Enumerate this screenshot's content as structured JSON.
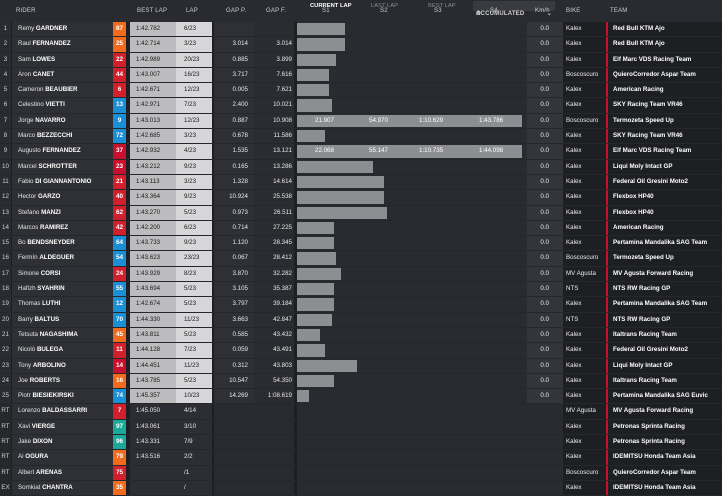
{
  "header": {
    "rider": "RIDER",
    "best_lap": "BEST LAP",
    "lap": "LAP",
    "gap_p": "GAP P.",
    "gap_f": "GAP F.",
    "bike": "BIKE",
    "team": "TEAM",
    "tabs": {
      "current": "CURRENT LAP",
      "last": "LAST LAP",
      "best": "BEST LAP",
      "accumulated": "ACCUMULATED"
    },
    "s1": "S1",
    "s2": "S2",
    "s3": "S3",
    "s4": "S4",
    "kmh": "Km/h"
  },
  "colors": {
    "team_accent": "#c8102e",
    "sector_bar": "#8d8e91"
  },
  "rows": [
    {
      "pos": "1",
      "first": "Remy",
      "last": "GARDNER",
      "num": "87",
      "num_color": "#f26a1b",
      "best": "1:42.782",
      "lap": "6/23",
      "gap_p": "",
      "gap_f": "",
      "bar": 0.21,
      "s1": "",
      "s2": "",
      "s3": "",
      "s4": "",
      "kmh": "0.0",
      "bike": "Kalex",
      "team": "Red Bull KTM Ajo"
    },
    {
      "pos": "2",
      "first": "Raul",
      "last": "FERNANDEZ",
      "num": "25",
      "num_color": "#f26a1b",
      "best": "1:42.714",
      "lap": "3/23",
      "gap_p": "3.014",
      "gap_f": "3.014",
      "bar": 0.21,
      "s1": "",
      "s2": "",
      "s3": "",
      "s4": "",
      "kmh": "0.0",
      "bike": "Kalex",
      "team": "Red Bull KTM Ajo"
    },
    {
      "pos": "3",
      "first": "Sam",
      "last": "LOWES",
      "num": "22",
      "num_color": "#d11f2b",
      "best": "1:42.989",
      "lap": "20/23",
      "gap_p": "0.885",
      "gap_f": "3.899",
      "bar": 0.17,
      "s1": "",
      "s2": "",
      "s3": "",
      "s4": "",
      "kmh": "0.0",
      "bike": "Kalex",
      "team": "Elf Marc VDS Racing Team"
    },
    {
      "pos": "4",
      "first": "Aron",
      "last": "CANET",
      "num": "44",
      "num_color": "#d11f2b",
      "best": "1:43.007",
      "lap": "16/23",
      "gap_p": "3.717",
      "gap_f": "7.616",
      "bar": 0.14,
      "s1": "",
      "s2": "",
      "s3": "",
      "s4": "",
      "kmh": "0.0",
      "bike": "Boscoscuro",
      "team": "QuieroCorredor Aspar Team"
    },
    {
      "pos": "5",
      "first": "Cameron",
      "last": "BEAUBIER",
      "num": "6",
      "num_color": "#d11f2b",
      "best": "1:42.671",
      "lap": "12/23",
      "gap_p": "0.005",
      "gap_f": "7.621",
      "bar": 0.14,
      "s1": "",
      "s2": "",
      "s3": "",
      "s4": "",
      "kmh": "0.0",
      "bike": "Kalex",
      "team": "American Racing"
    },
    {
      "pos": "6",
      "first": "Celestino",
      "last": "VIETTI",
      "num": "13",
      "num_color": "#1a8fd6",
      "best": "1:42.971",
      "lap": "7/23",
      "gap_p": "2.400",
      "gap_f": "10.021",
      "bar": 0.15,
      "s1": "",
      "s2": "",
      "s3": "",
      "s4": "",
      "kmh": "0.0",
      "bike": "Kalex",
      "team": "SKY Racing Team VR46"
    },
    {
      "pos": "7",
      "first": "Jorge",
      "last": "NAVARRO",
      "num": "9",
      "num_color": "#1a8fd6",
      "best": "1:43.013",
      "lap": "12/23",
      "gap_p": "0.887",
      "gap_f": "10.908",
      "bar": 0.98,
      "s1": "21.907",
      "s2": "54.970",
      "s3": "1:10.629",
      "s4": "1:43.786",
      "kmh": "0.0",
      "bike": "Boscoscuro",
      "team": "Termozeta Speed Up"
    },
    {
      "pos": "8",
      "first": "Marco",
      "last": "BEZZECCHI",
      "num": "72",
      "num_color": "#1a8fd6",
      "best": "1:42.685",
      "lap": "3/23",
      "gap_p": "0.678",
      "gap_f": "11.586",
      "bar": 0.12,
      "s1": "",
      "s2": "",
      "s3": "",
      "s4": "",
      "kmh": "0.0",
      "bike": "Kalex",
      "team": "SKY Racing Team VR46"
    },
    {
      "pos": "9",
      "first": "Augusto",
      "last": "FERNANDEZ",
      "num": "37",
      "num_color": "#c8102e",
      "best": "1:42.932",
      "lap": "4/23",
      "gap_p": "1.535",
      "gap_f": "13.121",
      "bar": 0.98,
      "s1": "22.068",
      "s2": "55.147",
      "s3": "1:10.735",
      "s4": "1:44.098",
      "kmh": "0.0",
      "bike": "Kalex",
      "team": "Elf Marc VDS Racing Team"
    },
    {
      "pos": "10",
      "first": "Marcel",
      "last": "SCHROTTER",
      "num": "23",
      "num_color": "#c8102e",
      "best": "1:43.212",
      "lap": "9/23",
      "gap_p": "0.165",
      "gap_f": "13.286",
      "bar": 0.33,
      "s1": "",
      "s2": "",
      "s3": "",
      "s4": "",
      "kmh": "0.0",
      "bike": "Kalex",
      "team": "Liqui Moly Intact GP"
    },
    {
      "pos": "11",
      "first": "Fabio",
      "last": "DI GIANNANTONIO",
      "num": "21",
      "num_color": "#d11f2b",
      "best": "1:43.113",
      "lap": "3/23",
      "gap_p": "1.328",
      "gap_f": "14.614",
      "bar": 0.38,
      "s1": "",
      "s2": "",
      "s3": "",
      "s4": "",
      "kmh": "0.0",
      "bike": "Kalex",
      "team": "Federal Oil Gresini Moto2"
    },
    {
      "pos": "12",
      "first": "Hector",
      "last": "GARZO",
      "num": "40",
      "num_color": "#d11f2b",
      "best": "1:43.364",
      "lay": "",
      "lap": "9/23",
      "gap_p": "10.924",
      "gap_f": "25.538",
      "bar": 0.38,
      "s1": "",
      "s2": "",
      "s3": "",
      "s4": "",
      "kmh": "0.0",
      "bike": "Kalex",
      "team": "Flexbox HP40"
    },
    {
      "pos": "13",
      "first": "Stefano",
      "last": "MANZI",
      "num": "62",
      "num_color": "#d11f2b",
      "best": "1:43.270",
      "lap": "5/23",
      "gap_p": "0.973",
      "gap_f": "26.511",
      "bar": 0.39,
      "s1": "",
      "s2": "",
      "s3": "",
      "s4": "",
      "kmh": "0.0",
      "bike": "Kalex",
      "team": "Flexbox HP40"
    },
    {
      "pos": "14",
      "first": "Marcos",
      "last": "RAMIREZ",
      "num": "42",
      "num_color": "#d11f2b",
      "best": "1:42.200",
      "lap": "6/23",
      "gap_p": "0.714",
      "gap_f": "27.225",
      "bar": 0.16,
      "s1": "",
      "s2": "",
      "s3": "",
      "s4": "",
      "kmh": "0.0",
      "bike": "Kalex",
      "team": "American Racing"
    },
    {
      "pos": "15",
      "first": "Bo",
      "last": "BENDSNEYDER",
      "num": "64",
      "num_color": "#1a8fd6",
      "best": "1:43.733",
      "lap": "9/23",
      "gap_p": "1.120",
      "gap_f": "28.345",
      "bar": 0.16,
      "s1": "",
      "s2": "",
      "s3": "",
      "s4": "",
      "kmh": "0.0",
      "bike": "Kalex",
      "team": "Pertamina Mandalika SAG Team"
    },
    {
      "pos": "16",
      "first": "Fermín",
      "last": "ALDEGUER",
      "num": "54",
      "num_color": "#1a8fd6",
      "best": "1:43.623",
      "lap": "23/23",
      "gap_p": "0.067",
      "gap_f": "28.412",
      "bar": 0.17,
      "s1": "",
      "s2": "",
      "s3": "",
      "s4": "",
      "kmh": "0.0",
      "bike": "Boscoscuro",
      "team": "Termozeta Speed Up"
    },
    {
      "pos": "17",
      "first": "Simone",
      "last": "CORSI",
      "num": "24",
      "num_color": "#d11f2b",
      "best": "1:43.929",
      "lap": "8/23",
      "gap_p": "3.870",
      "gap_f": "32.282",
      "bar": 0.19,
      "s1": "",
      "s2": "",
      "s3": "",
      "s4": "",
      "kmh": "0.0",
      "bike": "MV Agusta",
      "team": "MV Agusta Forward Racing"
    },
    {
      "pos": "18",
      "first": "Hafizh",
      "last": "SYAHRIN",
      "num": "55",
      "num_color": "#1a8fd6",
      "best": "1:43.694",
      "lap": "5/23",
      "gap_p": "3.105",
      "gap_f": "35.387",
      "bar": 0.16,
      "s1": "",
      "s2": "",
      "s3": "",
      "s4": "",
      "kmh": "0.0",
      "bike": "NTS",
      "team": "NTS RW Racing GP"
    },
    {
      "pos": "19",
      "first": "Thomas",
      "last": "LUTHI",
      "num": "12",
      "num_color": "#1a8fd6",
      "best": "1:42.674",
      "lap": "5/23",
      "gap_p": "3.797",
      "gap_f": "39.184",
      "bar": 0.16,
      "s1": "",
      "s2": "",
      "s3": "",
      "s4": "",
      "kmh": "0.0",
      "bike": "Kalex",
      "team": "Pertamina Mandalika SAG Team"
    },
    {
      "pos": "20",
      "first": "Barry",
      "last": "BALTUS",
      "num": "70",
      "num_color": "#1a8fd6",
      "best": "1:44.330",
      "lap": "11/23",
      "gap_p": "3.663",
      "gap_f": "42.847",
      "bar": 0.15,
      "s1": "",
      "s2": "",
      "s3": "",
      "s4": "",
      "kmh": "0.0",
      "bike": "NTS",
      "team": "NTS RW Racing GP"
    },
    {
      "pos": "21",
      "first": "Tetsuta",
      "last": "NAGASHIMA",
      "num": "45",
      "num_color": "#f26a1b",
      "best": "1:43.811",
      "lap": "5/23",
      "gap_p": "0.585",
      "gap_f": "43.432",
      "bar": 0.1,
      "s1": "",
      "s2": "",
      "s3": "",
      "s4": "",
      "kmh": "0.0",
      "bike": "Kalex",
      "team": "Italtrans Racing Team"
    },
    {
      "pos": "22",
      "first": "Nicolò",
      "last": "BULEGA",
      "num": "11",
      "num_color": "#d11f2b",
      "best": "1:44.128",
      "lap": "7/23",
      "gap_p": "0.059",
      "gap_f": "43.491",
      "bar": 0.12,
      "s1": "",
      "s2": "",
      "s3": "",
      "s4": "",
      "kmh": "0.0",
      "bike": "Kalex",
      "team": "Federal Oil Gresini Moto2"
    },
    {
      "pos": "23",
      "first": "Tony",
      "last": "ARBOLINO",
      "num": "14",
      "num_color": "#c8102e",
      "best": "1:44.451",
      "lap": "11/23",
      "gap_p": "0.312",
      "gap_f": "43.803",
      "bar": 0.26,
      "s1": "",
      "s2": "",
      "s3": "",
      "s4": "",
      "kmh": "0.0",
      "bike": "Kalex",
      "team": "Liqui Moly Intact GP"
    },
    {
      "pos": "24",
      "first": "Joe",
      "last": "ROBERTS",
      "num": "16",
      "num_color": "#f26a1b",
      "best": "1:43.785",
      "lap": "5/23",
      "gap_p": "10.547",
      "gap_f": "54.350",
      "bar": 0.16,
      "s1": "",
      "s2": "",
      "s3": "",
      "s4": "",
      "kmh": "0.0",
      "bike": "Kalex",
      "team": "Italtrans Racing Team"
    },
    {
      "pos": "25",
      "first": "Piotr",
      "last": "BIESIEKIRSKI",
      "num": "74",
      "num_color": "#1a8fd6",
      "best": "1:45.357",
      "lap": "10/23",
      "gap_p": "14.269",
      "gap_f": "1:08.619",
      "bar": 0.05,
      "s1": "",
      "s2": "",
      "s3": "",
      "s4": "",
      "kmh": "0.0",
      "bike": "Kalex",
      "team": "Pertamina Mandalika SAG Euvic"
    },
    {
      "pos": "RT",
      "first": "Lorenzo",
      "last": "BALDASSARRI",
      "flag": "P",
      "num": "7",
      "num_color": "#d11f2b",
      "best": "1:45.050",
      "lap": "4/14",
      "gap_p": "",
      "gap_f": "",
      "bar": 0,
      "s1": "",
      "s2": "",
      "s3": "",
      "s4": "",
      "kmh": "",
      "bike": "MV Agusta",
      "team": "MV Agusta Forward Racing",
      "out": true
    },
    {
      "pos": "RT",
      "first": "Xavi",
      "last": "VIERGE",
      "num": "97",
      "num_color": "#1aa89a",
      "best": "1:43.061",
      "lap": "3/10",
      "gap_p": "",
      "gap_f": "",
      "bar": 0,
      "s1": "",
      "s2": "",
      "s3": "",
      "s4": "",
      "kmh": "",
      "bike": "Kalex",
      "team": "Petronas Sprinta Racing",
      "out": true
    },
    {
      "pos": "RT",
      "first": "Jake",
      "last": "DIXON",
      "num": "96",
      "num_color": "#1aa89a",
      "best": "1:43.331",
      "lap": "7/9",
      "gap_p": "",
      "gap_f": "",
      "bar": 0,
      "s1": "",
      "s2": "",
      "s3": "",
      "s4": "",
      "kmh": "",
      "bike": "Kalex",
      "team": "Petronas Sprinta Racing",
      "out": true
    },
    {
      "pos": "RT",
      "first": "Ai",
      "last": "OGURA",
      "num": "79",
      "num_color": "#f26a1b",
      "best": "1:43.516",
      "lap": "2/2",
      "gap_p": "",
      "gap_f": "",
      "bar": 0,
      "s1": "",
      "s2": "",
      "s3": "",
      "s4": "",
      "kmh": "",
      "bike": "Kalex",
      "team": "IDEMITSU Honda Team Asia",
      "out": true
    },
    {
      "pos": "RT",
      "first": "Albert",
      "last": "ARENAS",
      "num": "75",
      "num_color": "#d11f2b",
      "best": "",
      "lap": "/1",
      "gap_p": "",
      "gap_f": "",
      "bar": 0,
      "s1": "",
      "s2": "",
      "s3": "",
      "s4": "",
      "kmh": "",
      "bike": "Boscoscuro",
      "team": "QuieroCorredor Aspar Team",
      "out": true
    },
    {
      "pos": "EX",
      "first": "Somkiat",
      "last": "CHANTRA",
      "num": "35",
      "num_color": "#f26a1b",
      "best": "",
      "lap": "/",
      "gap_p": "",
      "gap_f": "",
      "bar": 0,
      "s1": "",
      "s2": "",
      "s3": "",
      "s4": "",
      "kmh": "",
      "bike": "Kalex",
      "team": "IDEMITSU Honda Team Asia",
      "out": true
    }
  ]
}
